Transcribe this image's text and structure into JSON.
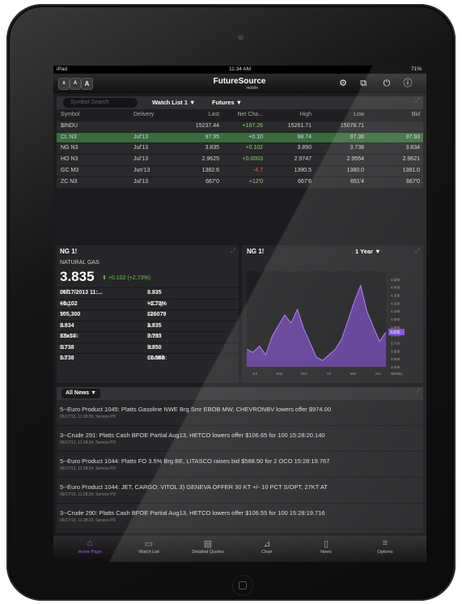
{
  "status_bar": {
    "device": "iPad",
    "time": "11:34 AM",
    "battery": "71%"
  },
  "app_bar": {
    "font_buttons": [
      "A",
      "A",
      "A"
    ],
    "brand": "FutureSource",
    "brand_sub": "mobile",
    "icons": [
      "settings-icon",
      "layout-icon",
      "power-icon",
      "info-icon"
    ]
  },
  "watchlist": {
    "search_placeholder": "Symbol Search",
    "list_dropdown": "Watch List 1",
    "type_dropdown": "Futures",
    "columns": [
      "Symbol",
      "Delivery",
      "Last",
      "Net Cha...",
      "High",
      "Low",
      "Bid"
    ],
    "rows": [
      [
        "$INDU",
        "",
        "15237.44",
        "+167.26",
        "15261.71",
        "15078.71",
        ""
      ],
      [
        "CL N3",
        "Jul'13",
        "97.95",
        "+0.10",
        "98.74",
        "97.38",
        "97.93"
      ],
      [
        "NG N3",
        "Jul'13",
        "3.835",
        "+0.102",
        "3.850",
        "3.738",
        "3.834"
      ],
      [
        "HO N3",
        "Jul'13",
        "2.9625",
        "+0.0003",
        "2.9747",
        "2.9554",
        "2.9621"
      ],
      [
        "GC M3",
        "Jun'13",
        "1382.6",
        "-4.7",
        "1390.5",
        "1380.0",
        "1381.0"
      ],
      [
        "ZC N3",
        "Jul'13",
        "667'0",
        "+12'0",
        "667'6",
        "651'4",
        "667'0"
      ]
    ],
    "colors": {
      "positive": "#8ad46a",
      "negative": "#e05a5a",
      "selected_row": "#3c6c3e"
    }
  },
  "quote": {
    "symbol": "NG 1!",
    "name": "NATURAL GAS",
    "last": "3.835",
    "change": "+0.102 (+2.73%)",
    "grid": [
      [
        "LTT: ",
        "06/17/2013 11:...",
        "L: ",
        "3.835"
      ],
      [
        "Chg: ",
        "+0.102",
        "%Chg: ",
        "+2.73%"
      ],
      [
        "V: ",
        "105,300",
        "OI: ",
        "126079"
      ],
      [
        "B: ",
        "3.834",
        "A: ",
        "3.835"
      ],
      [
        "BSxAS: ",
        "13x14",
        "Prev: ",
        "3.733"
      ],
      [
        "O: ",
        "3.738",
        "H: ",
        "3.850"
      ],
      [
        "Lo: ",
        "3.738",
        "Contrib: ",
        "10.560"
      ]
    ]
  },
  "chart": {
    "symbol": "NG 1!",
    "range": "1 Year",
    "y_ticks": [
      "4.500",
      "4.400",
      "4.300",
      "4.200",
      "4.100",
      "4.000",
      "3.900",
      "3.800",
      "3.700",
      "3.600",
      "3.500",
      "3.400"
    ],
    "current_label": "3.835",
    "x_ticks": [
      "Jul",
      "Sep",
      "Nov",
      "'13",
      "Mar",
      "Jun"
    ],
    "interval_label": "Weekly",
    "line_color": "#a77cf0",
    "fill_color": "#6a3ea8",
    "chart_data": {
      "type": "area",
      "x": [
        "Jul",
        "Aug",
        "Aug",
        "Sep",
        "Sep",
        "Oct",
        "Oct",
        "Nov",
        "Nov",
        "Dec",
        "Dec",
        "Jan",
        "Jan",
        "Feb",
        "Feb",
        "Mar",
        "Mar",
        "Apr",
        "Apr",
        "May",
        "May",
        "Jun",
        "Jun"
      ],
      "values": [
        3.62,
        3.58,
        3.66,
        3.55,
        3.78,
        3.92,
        4.05,
        3.95,
        4.12,
        3.88,
        3.7,
        3.52,
        3.48,
        3.55,
        3.62,
        3.75,
        3.98,
        4.22,
        4.42,
        4.1,
        3.9,
        3.72,
        3.835
      ],
      "ylim": [
        3.4,
        4.6
      ]
    }
  },
  "news": {
    "filter": "All News",
    "items": [
      {
        "headline": "5--Euro Product 1045: Platts Gasoline NWE Brg Smr EBOB MW, CHEVRONBV lowers offer $974.00",
        "meta": "06/17/13, 11:28:26, Service PD"
      },
      {
        "headline": "3--Crude 291: Platts Cash BFOE Partial Aug13, HETCO lowers offer $106.65 for 100 15:28:20.140",
        "meta": "06/17/13, 11:28:24, Service PD"
      },
      {
        "headline": "5--Euro Product 1044: Platts FO 3.5% Brg BE, LITASCO raises bid $588.50 for 2 OCO 15:28:19.767",
        "meta": "06/17/13, 11:28:24, Service PD"
      },
      {
        "headline": "5--Euro Product 1044: JET, CARGO: VITOL 3) GENEVA OFFER 30 KT +/- 10 PCT S/OPT, 27KT AT",
        "meta": "06/17/13, 11:28:24, Service PD"
      },
      {
        "headline": "3--Crude 290: Platts Cash BFOE Partial Aug13, HETCO lowers offer $106.55 for 100 15:28:19.716",
        "meta": "06/17/13, 11:28:22, Service PD"
      }
    ]
  },
  "tabs": [
    {
      "label": "Home Page",
      "icon": "house-icon",
      "glyph": "⌂"
    },
    {
      "label": "Watch List",
      "icon": "watchlist-icon",
      "glyph": "▭"
    },
    {
      "label": "Detailed Quotes",
      "icon": "quotes-icon",
      "glyph": "▤"
    },
    {
      "label": "Chart",
      "icon": "chart-icon",
      "glyph": "⊿"
    },
    {
      "label": "News",
      "icon": "news-icon",
      "glyph": "▯"
    },
    {
      "label": "Options",
      "icon": "options-icon",
      "glyph": "≡"
    }
  ],
  "active_tab": "Home Page",
  "accent_color": "#a55bff"
}
